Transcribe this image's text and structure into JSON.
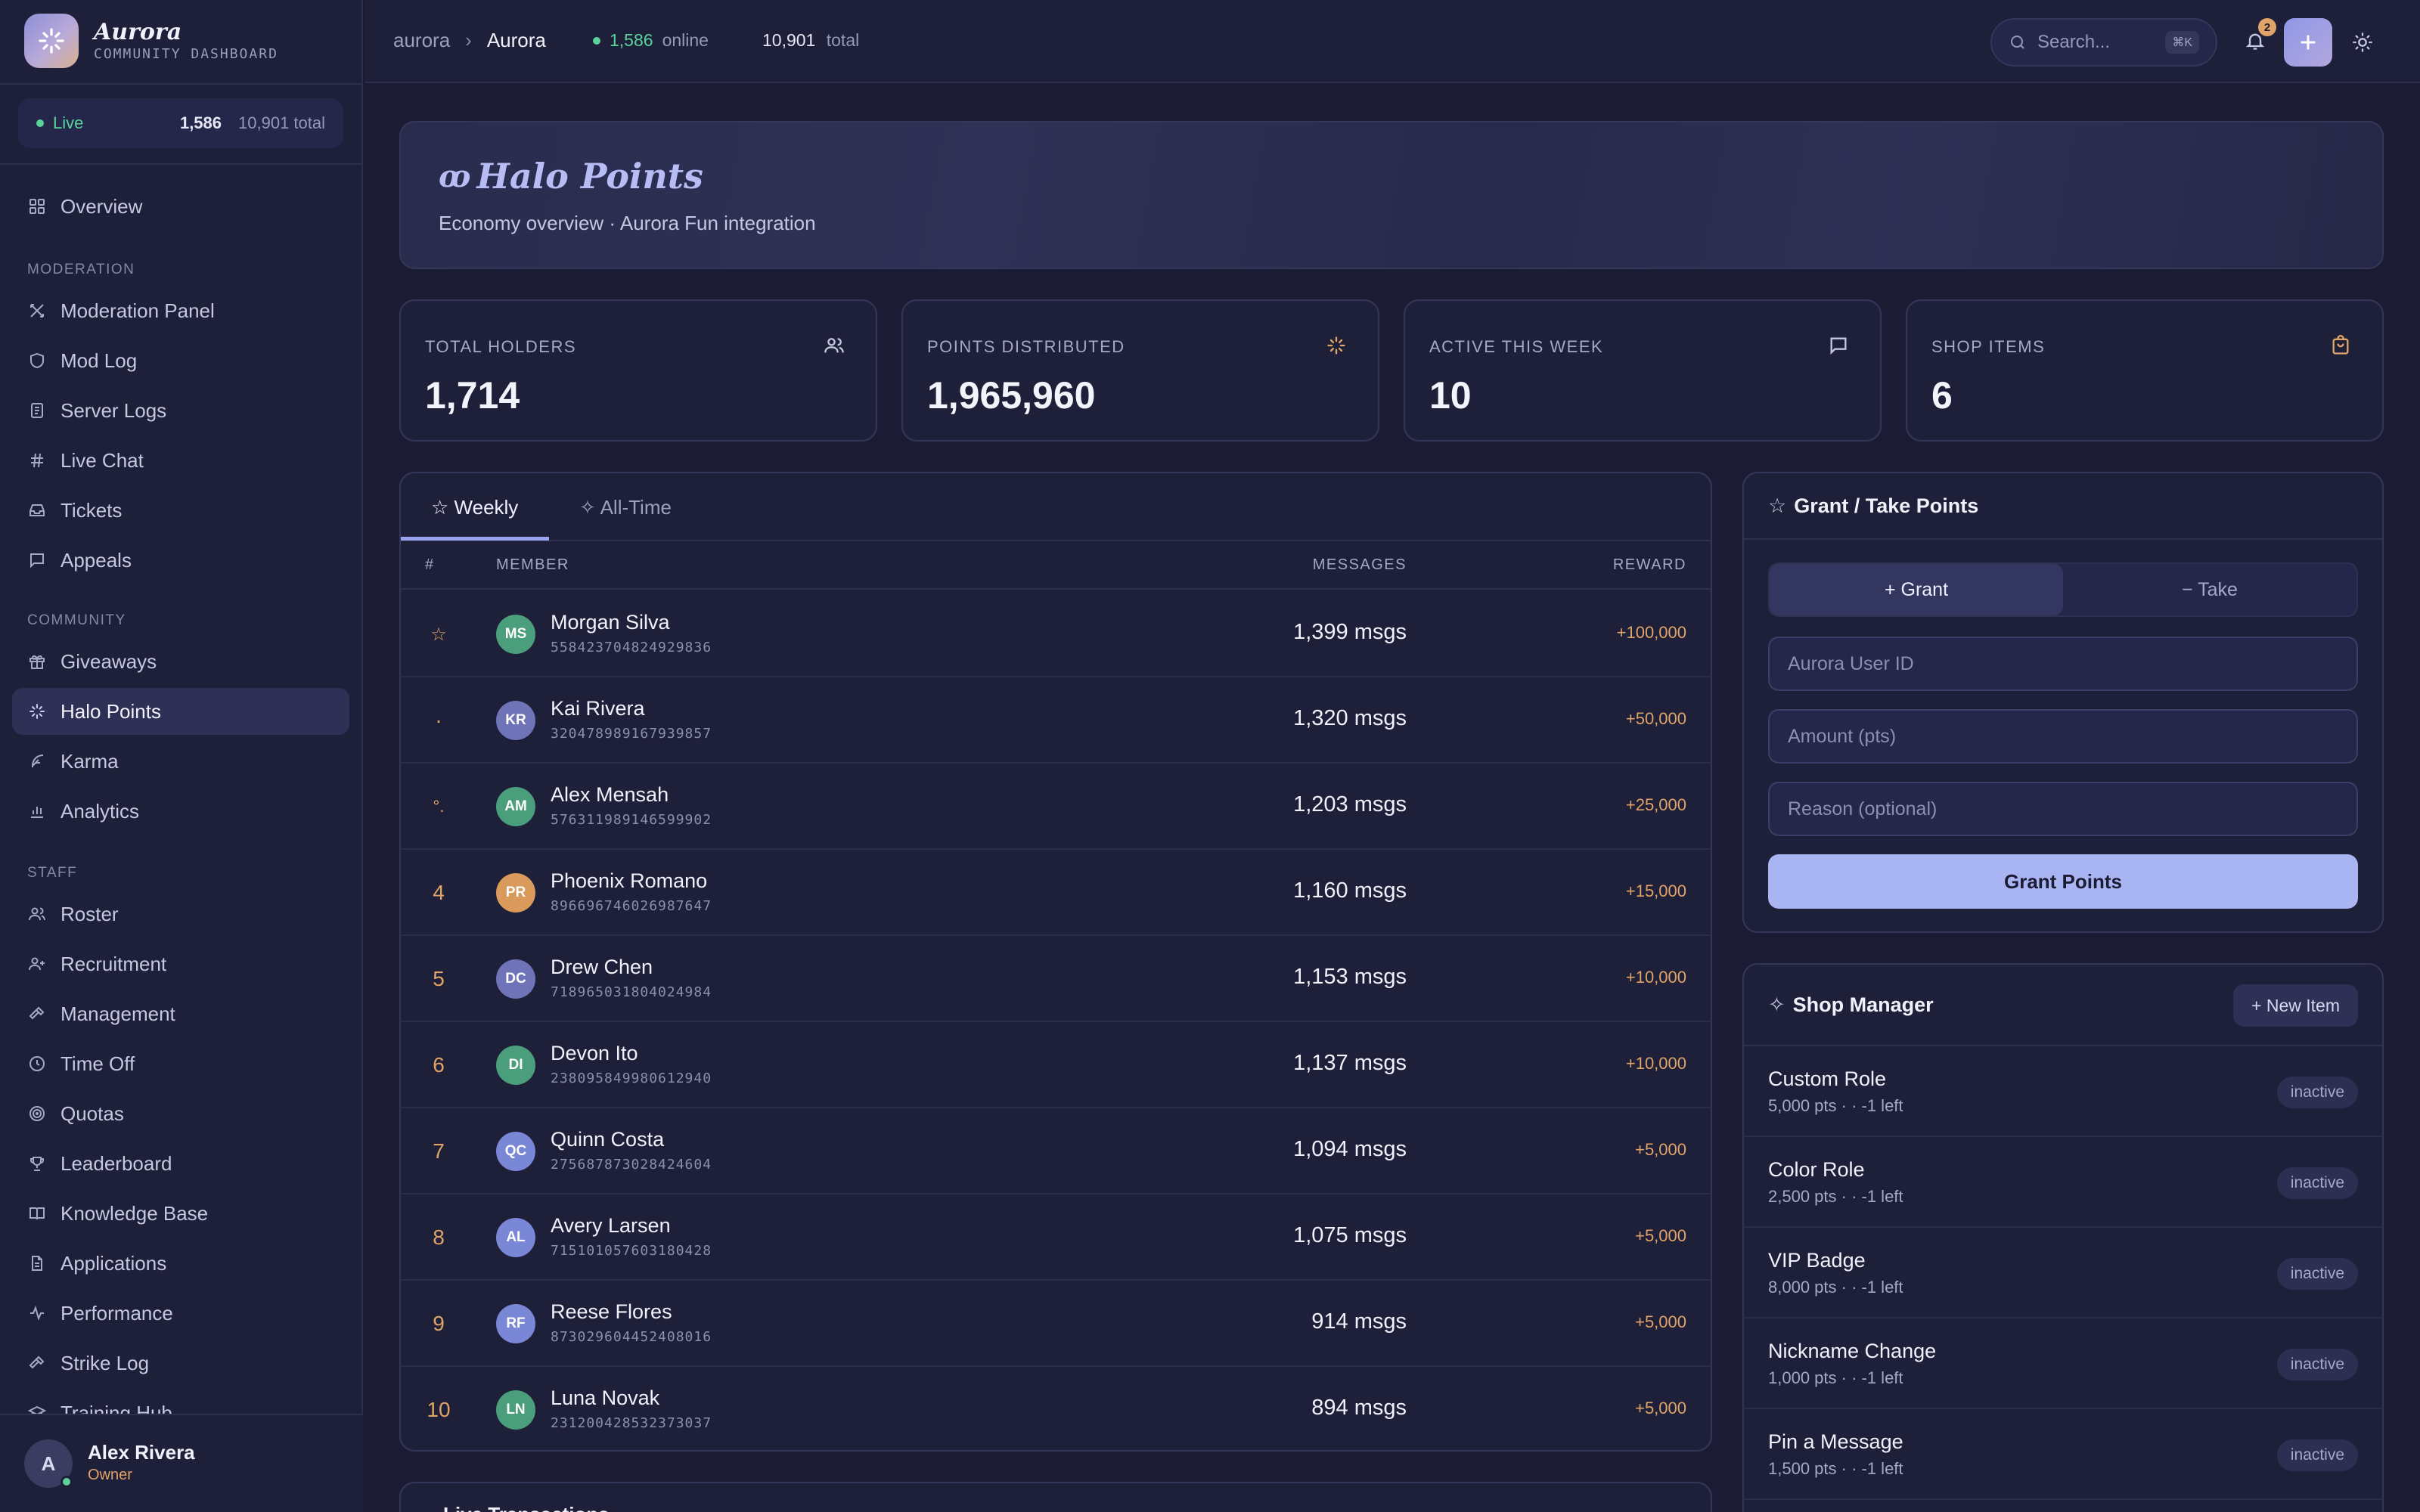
{
  "brand": {
    "name": "Aurora",
    "subtitle": "COMMUNITY DASHBOARD"
  },
  "live": {
    "label": "Live",
    "online": "1,586",
    "total": "10,901 total"
  },
  "sidebar": {
    "overview": "Overview",
    "sections": {
      "moderation": "MODERATION",
      "community": "COMMUNITY",
      "staff": "STAFF"
    },
    "moderation_items": [
      "Moderation Panel",
      "Mod Log",
      "Server Logs",
      "Live Chat",
      "Tickets",
      "Appeals"
    ],
    "community_items": [
      "Giveaways",
      "Halo Points",
      "Karma",
      "Analytics"
    ],
    "staff_items": [
      "Roster",
      "Recruitment",
      "Management",
      "Time Off",
      "Quotas",
      "Leaderboard",
      "Knowledge Base",
      "Applications",
      "Performance",
      "Strike Log",
      "Training Hub"
    ],
    "active_item": "Halo Points"
  },
  "user": {
    "initial": "A",
    "name": "Alex Rivera",
    "role": "Owner"
  },
  "topbar": {
    "breadcrumb": [
      "aurora",
      "Aurora"
    ],
    "online_value": "1,586",
    "online_label": "online",
    "total_value": "10,901",
    "total_label": "total",
    "search_placeholder": "Search...",
    "search_shortcut": "⌘K",
    "notification_count": "2"
  },
  "hero": {
    "title": "Halo Points",
    "subtitle": "Economy overview · Aurora Fun integration"
  },
  "stats": [
    {
      "label": "TOTAL HOLDERS",
      "value": "1,714",
      "icon": "users-icon"
    },
    {
      "label": "POINTS DISTRIBUTED",
      "value": "1,965,960",
      "icon": "sparkles-icon"
    },
    {
      "label": "ACTIVE THIS WEEK",
      "value": "10",
      "icon": "message-icon"
    },
    {
      "label": "SHOP ITEMS",
      "value": "6",
      "icon": "shopping-bag-icon"
    }
  ],
  "leaderboard": {
    "tabs": [
      "☆ Weekly",
      "✧ All-Time"
    ],
    "active_tab": "☆ Weekly",
    "columns": {
      "rank": "#",
      "member": "MEMBER",
      "messages": "MESSAGES",
      "reward": "REWARD"
    },
    "rows": [
      {
        "rank": "☆",
        "initials": "MS",
        "color": "#4a9e7c",
        "name": "Morgan Silva",
        "id": "558423704824929836",
        "messages": "1,399 msgs",
        "reward": "+100,000"
      },
      {
        "rank": "·",
        "initials": "KR",
        "color": "#6f74b8",
        "name": "Kai Rivera",
        "id": "320478989167939857",
        "messages": "1,320 msgs",
        "reward": "+50,000"
      },
      {
        "rank": "°.",
        "initials": "AM",
        "color": "#4a9e7c",
        "name": "Alex Mensah",
        "id": "576311989146599902",
        "messages": "1,203 msgs",
        "reward": "+25,000"
      },
      {
        "rank": "4",
        "initials": "PR",
        "color": "#d99a5b",
        "name": "Phoenix Romano",
        "id": "896696746026987647",
        "messages": "1,160 msgs",
        "reward": "+15,000"
      },
      {
        "rank": "5",
        "initials": "DC",
        "color": "#6f74b8",
        "name": "Drew Chen",
        "id": "718965031804024984",
        "messages": "1,153 msgs",
        "reward": "+10,000"
      },
      {
        "rank": "6",
        "initials": "DI",
        "color": "#4a9e7c",
        "name": "Devon Ito",
        "id": "238095849980612940",
        "messages": "1,137 msgs",
        "reward": "+10,000"
      },
      {
        "rank": "7",
        "initials": "QC",
        "color": "#7a86d6",
        "name": "Quinn Costa",
        "id": "275687873028424604",
        "messages": "1,094 msgs",
        "reward": "+5,000"
      },
      {
        "rank": "8",
        "initials": "AL",
        "color": "#7a86d6",
        "name": "Avery Larsen",
        "id": "715101057603180428",
        "messages": "1,075 msgs",
        "reward": "+5,000"
      },
      {
        "rank": "9",
        "initials": "RF",
        "color": "#7a86d6",
        "name": "Reese Flores",
        "id": "873029604452408016",
        "messages": "914 msgs",
        "reward": "+5,000"
      },
      {
        "rank": "10",
        "initials": "LN",
        "color": "#4a9e7c",
        "name": "Luna Novak",
        "id": "231200428532373037",
        "messages": "894 msgs",
        "reward": "+5,000"
      }
    ]
  },
  "grant": {
    "title": "Grant / Take Points",
    "star": "☆",
    "grant_tab": "+ Grant",
    "take_tab": "− Take",
    "user_id_placeholder": "Aurora User ID",
    "amount_placeholder": "Amount (pts)",
    "reason_placeholder": "Reason (optional)",
    "submit": "Grant Points"
  },
  "shop": {
    "title": "Shop Manager",
    "star": "✧",
    "new_item": "+ New Item",
    "items": [
      {
        "name": "Custom Role",
        "meta": "5,000 pts · · -1 left",
        "status": "inactive"
      },
      {
        "name": "Color Role",
        "meta": "2,500 pts · · -1 left",
        "status": "inactive"
      },
      {
        "name": "VIP Badge",
        "meta": "8,000 pts · · -1 left",
        "status": "inactive"
      },
      {
        "name": "Nickname Change",
        "meta": "1,000 pts · · -1 left",
        "status": "inactive"
      },
      {
        "name": "Pin a Message",
        "meta": "1,500 pts · · -1 left",
        "status": "inactive"
      }
    ]
  },
  "transactions": {
    "title": "Live Transactions"
  },
  "colors": {
    "accent": "#a9b4f2",
    "online": "#5ad29a",
    "reward": "#e0a468",
    "background": "#1b1c33"
  }
}
